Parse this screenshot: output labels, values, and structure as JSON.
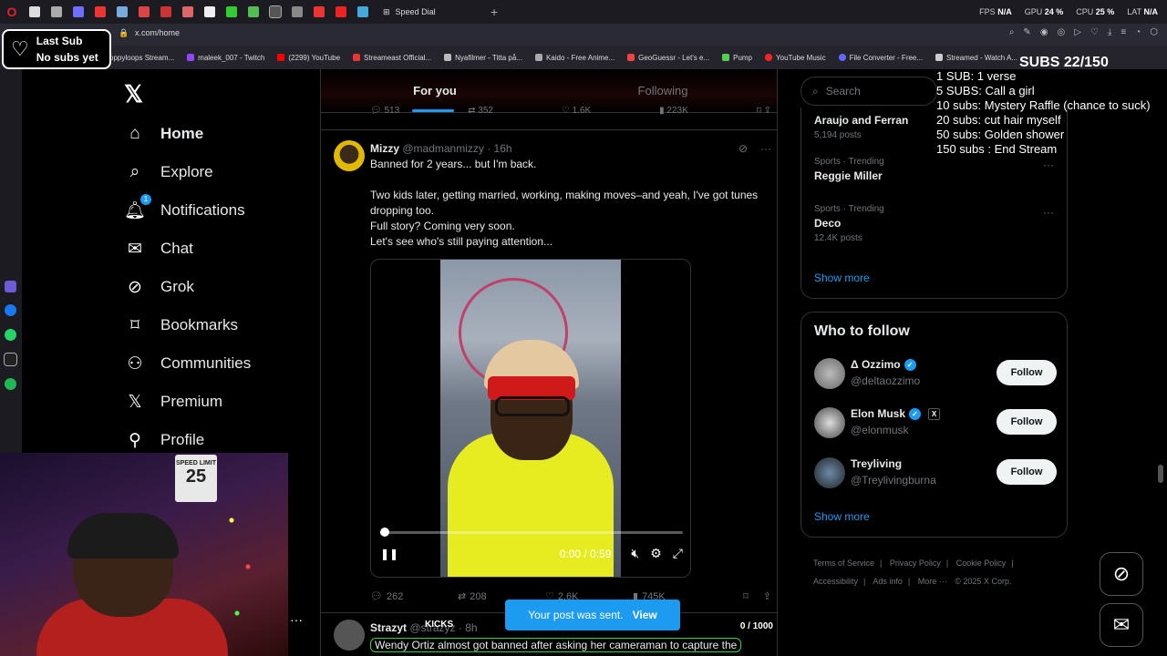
{
  "browser": {
    "active_tab": "Speed Dial",
    "url": "x.com/home",
    "stats": {
      "fps_label": "FPS",
      "fps": "N/A",
      "gpu_label": "GPU",
      "gpu": "24 %",
      "cpu_label": "CPU",
      "cpu": "25 %",
      "lat_label": "LAT",
      "lat": "N/A"
    },
    "bookmarks": [
      "oppyloops Stream...",
      "maleek_007 - Twitch",
      "(2299) YouTube",
      "Streameast Official...",
      "Nyafilmer - Titta på...",
      "Kaido - Free Anime...",
      "GeoGuessr - Let's e...",
      "Pump",
      "YouTube Music",
      "File Converter - Free...",
      "Streamed - Watch A..."
    ]
  },
  "last_sub": {
    "title": "Last Sub",
    "value": "No subs yet"
  },
  "nav": {
    "items": [
      {
        "label": "Home",
        "icon": "home-icon"
      },
      {
        "label": "Explore",
        "icon": "search-icon"
      },
      {
        "label": "Notifications",
        "icon": "bell-icon",
        "badge": "1"
      },
      {
        "label": "Chat",
        "icon": "mail-icon"
      },
      {
        "label": "Grok",
        "icon": "grok-icon"
      },
      {
        "label": "Bookmarks",
        "icon": "bookmark-icon"
      },
      {
        "label": "Communities",
        "icon": "communities-icon"
      },
      {
        "label": "Premium",
        "icon": "x-icon"
      },
      {
        "label": "Profile",
        "icon": "person-icon"
      }
    ]
  },
  "webcam": {
    "sign_top": "SPEED LIMIT",
    "sign_num": "25"
  },
  "timeline": {
    "tabs": [
      "For you",
      "Following"
    ],
    "prev_post_actions": [
      "513",
      "352",
      "1.6K",
      "223K"
    ],
    "post": {
      "name": "Mizzy",
      "handle": "@madmanmizzy · 16h",
      "lines": [
        "Banned for 2 years... but I'm back.",
        "Two kids later, getting married, working, making moves–and yeah, I've got tunes dropping too.",
        "Full story? Coming very soon.",
        "Let's see who's still paying attention..."
      ],
      "video": {
        "time": "0:00 / 0:59",
        "progress": 0.01
      },
      "actions": {
        "replies": "262",
        "reposts": "208",
        "likes": "2.6K",
        "views": "745K"
      }
    },
    "post2": {
      "name": "Strazyt",
      "handle": "@strazyz · 8h",
      "text": "Wendy Ortiz almost got banned after asking her cameraman to capture the",
      "kicks": "KICKS",
      "counter": "0 / 1000"
    },
    "toast": {
      "text": "Your post was sent.",
      "action": "View"
    }
  },
  "right": {
    "search_placeholder": "Search",
    "trends": [
      {
        "context": "",
        "title": "Araujo and Ferran",
        "count": "5,194 posts"
      },
      {
        "context": "Sports · Trending",
        "title": "Reggie Miller",
        "count": ""
      },
      {
        "context": "Sports · Trending",
        "title": "Deco",
        "count": "12.4K posts"
      }
    ],
    "show_more": "Show more",
    "who_to_follow": {
      "title": "Who to follow",
      "accounts": [
        {
          "name": "Δ Ozzimo",
          "handle": "@deltaozzimo",
          "button": "Follow"
        },
        {
          "name": "Elon Musk",
          "handle": "@elonmusk",
          "button": "Follow"
        },
        {
          "name": "Treyliving",
          "handle": "@Treylivingburna",
          "button": "Follow"
        }
      ],
      "show_more": "Show more"
    },
    "footer": [
      "Terms of Service",
      "|",
      "Privacy Policy",
      "|",
      "Cookie Policy",
      "|",
      "Accessibility",
      "|",
      "Ads info",
      "|",
      "More ···",
      "© 2025 X Corp."
    ]
  },
  "subs_overlay": {
    "title": "SUBS 22/150",
    "goals": [
      "1 SUB: 1 verse",
      "5 SUBS: Call a girl",
      "10 subs: Mystery Raffle (chance to suck)",
      "20 subs: cut hair myself",
      "50 subs: Golden shower",
      "150 subs : End Stream"
    ]
  }
}
